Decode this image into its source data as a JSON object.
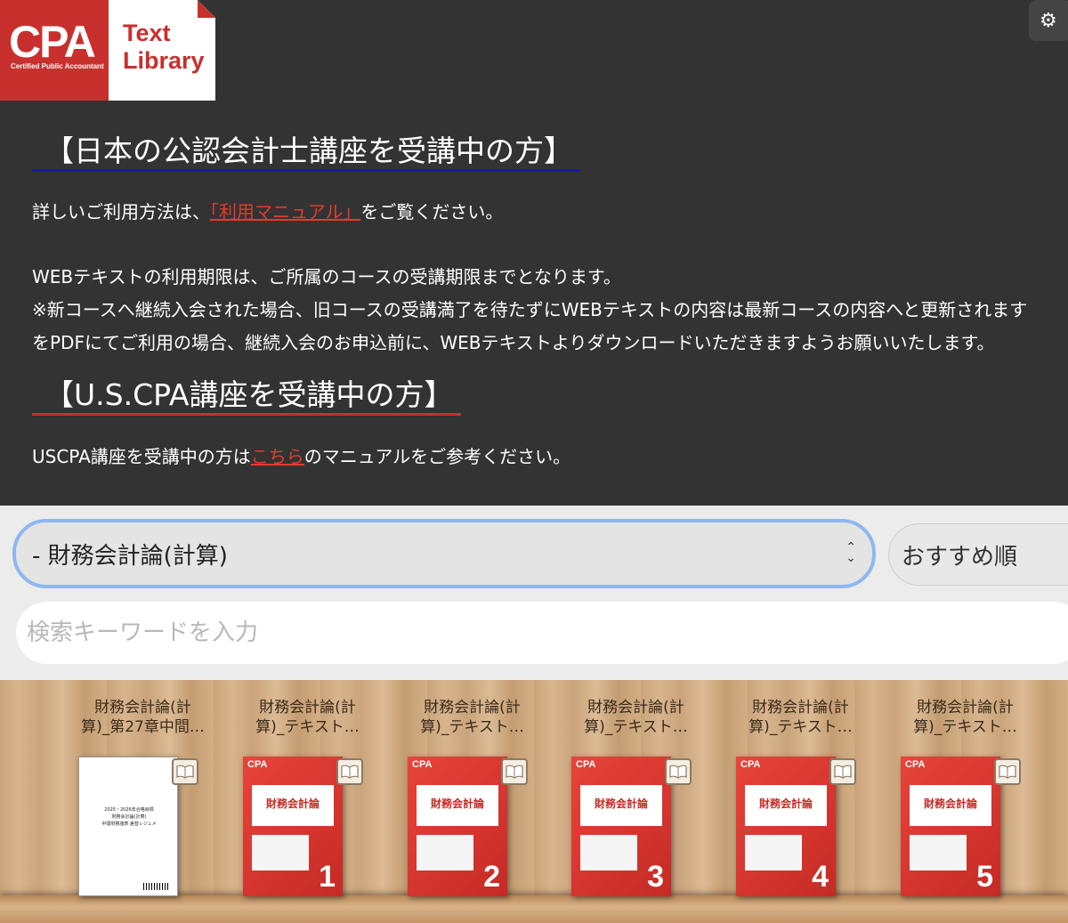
{
  "logo": {
    "brand": "CPA",
    "brand_sub": "Certified Public Accountant",
    "line1": "Text",
    "line2": "Library"
  },
  "settings": {
    "icon": "gear-icon"
  },
  "info": {
    "jp_heading": "【日本の公認会計士講座を受講中の方】",
    "manual_prefix": "詳しいご利用方法は、",
    "manual_link": "「利用マニュアル」",
    "manual_suffix": "をご覧ください。",
    "period_line1": "WEBテキストの利用期限は、ご所属のコースの受講期限までとなります。",
    "period_line2": "※新コースへ継続入会された場合、旧コースの受講満了を待たずにWEBテキストの内容は最新コースの内容へと更新されます",
    "period_line3": "をPDFにてご利用の場合、継続入会のお申込前に、WEBテキストよりダウンロードいただきますようお願いいたします。",
    "us_heading": "【U.S.CPA講座を受講中の方】",
    "us_prefix": "USCPA講座を受講中の方は",
    "us_link": "こちら",
    "us_suffix": "のマニュアルをご参考ください。"
  },
  "filter": {
    "category_selected": "- 財務会計論(計算)",
    "sort_selected": "おすすめ順",
    "search_placeholder": "検索キーワードを入力"
  },
  "books": [
    {
      "title_line1": "財務会計論(計",
      "title_line2": "算)_第27章中間…",
      "cover": "white",
      "number": "",
      "doc_title": "2025・2026年合格目標",
      "doc_sub1": "財務会計論(計算)",
      "doc_sub2": "中間財務諸表 差替レジュメ"
    },
    {
      "title_line1": "財務会計論(計",
      "title_line2": "算)_テキスト…",
      "cover": "red",
      "number": "1",
      "panel_title": "財務会計論"
    },
    {
      "title_line1": "財務会計論(計",
      "title_line2": "算)_テキスト…",
      "cover": "red",
      "number": "2",
      "panel_title": "財務会計論"
    },
    {
      "title_line1": "財務会計論(計",
      "title_line2": "算)_テキスト…",
      "cover": "red",
      "number": "3",
      "panel_title": "財務会計論"
    },
    {
      "title_line1": "財務会計論(計",
      "title_line2": "算)_テキスト…",
      "cover": "red",
      "number": "4",
      "panel_title": "財務会計論"
    },
    {
      "title_line1": "財務会計論(計",
      "title_line2": "算)_テキスト…",
      "cover": "red",
      "number": "5",
      "panel_title": "財務会計論"
    }
  ],
  "colors": {
    "accent_red": "#c8302e",
    "link_red": "#e23b2e",
    "heading_blue": "#1a1aa6",
    "focus_blue": "#8fb7f0",
    "background": "#333333"
  }
}
